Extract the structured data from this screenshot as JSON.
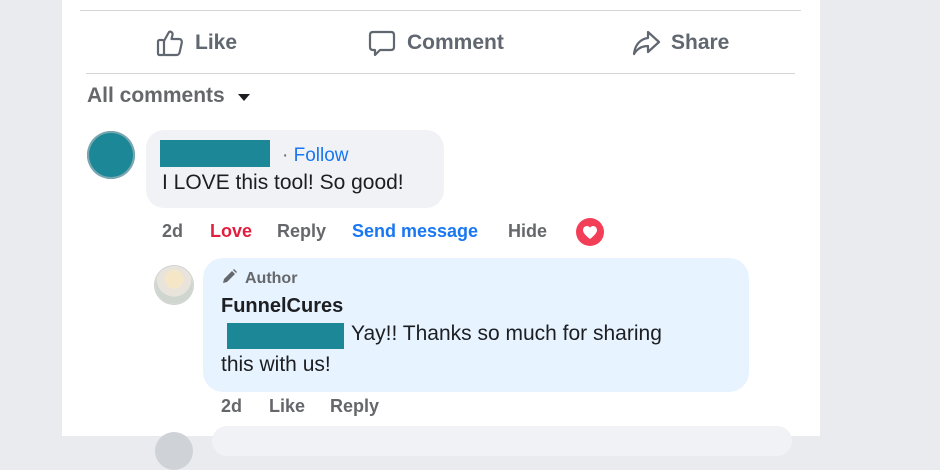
{
  "actions": {
    "like_label": "Like",
    "comment_label": "Comment",
    "share_label": "Share"
  },
  "comments_sort": {
    "label": "All comments"
  },
  "comment": {
    "follow_label": "Follow",
    "text": "I LOVE this tool! So good!",
    "time": "2d",
    "reaction_label": "Love",
    "reply_label": "Reply",
    "send_message_label": "Send message",
    "hide_label": "Hide"
  },
  "reply": {
    "badge": "Author",
    "author_name": "FunnelCures",
    "text_line1": "Yay!! Thanks so much for sharing",
    "text_line2": "this with us!",
    "time": "2d",
    "like_label": "Like",
    "reply_label": "Reply"
  },
  "colors": {
    "accent": "#1877f2",
    "love": "#e41e3f",
    "redaction": "#1b8797",
    "reply_bubble": "#e7f3ff"
  }
}
